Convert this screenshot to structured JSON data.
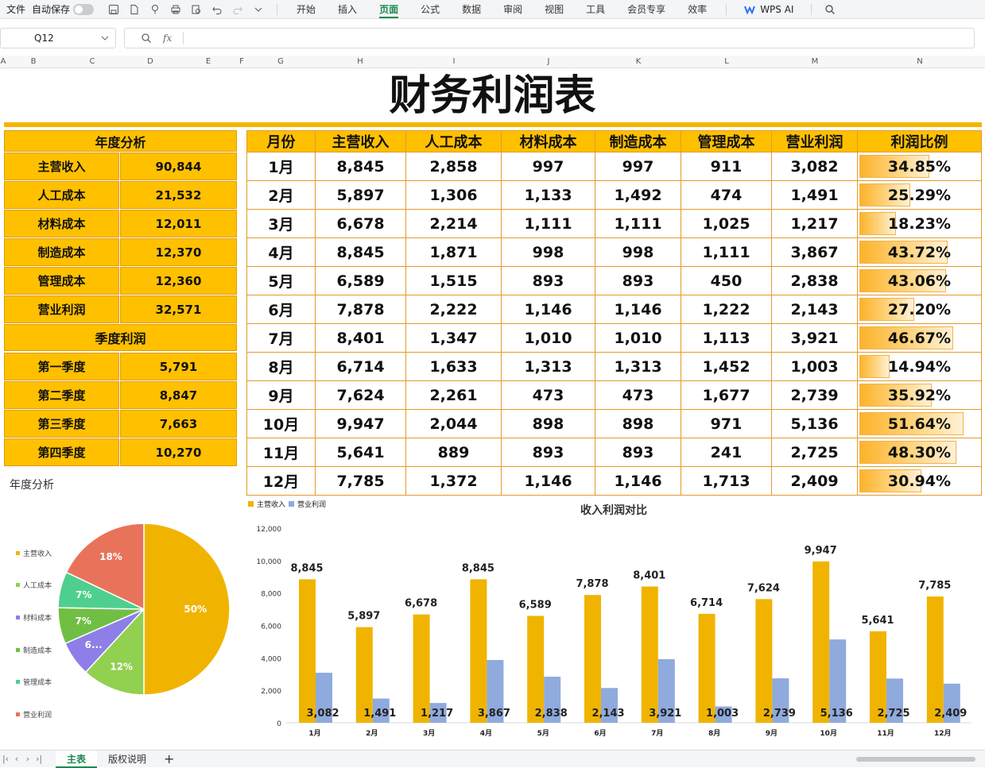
{
  "ribbon": {
    "file": "文件",
    "autosave": "自动保存",
    "menus": [
      "开始",
      "插入",
      "页面",
      "公式",
      "数据",
      "审阅",
      "视图",
      "工具",
      "会员专享",
      "效率"
    ],
    "active_menu": "页面",
    "wps_ai": "WPS AI"
  },
  "formula_bar": {
    "cell_ref": "Q12",
    "fx_label": "fx",
    "value": ""
  },
  "columns": [
    "A",
    "B",
    "C",
    "D",
    "E",
    "F",
    "G",
    "H",
    "I",
    "J",
    "K",
    "L",
    "M",
    "N"
  ],
  "title": "财务利润表",
  "annual": {
    "header": "年度分析",
    "rows": [
      {
        "label": "主营收入",
        "value": "90,844"
      },
      {
        "label": "人工成本",
        "value": "21,532"
      },
      {
        "label": "材料成本",
        "value": "12,011"
      },
      {
        "label": "制造成本",
        "value": "12,370"
      },
      {
        "label": "管理成本",
        "value": "12,360"
      },
      {
        "label": "营业利润",
        "value": "32,571"
      }
    ]
  },
  "quarter": {
    "header": "季度利润",
    "rows": [
      {
        "label": "第一季度",
        "value": "5,791"
      },
      {
        "label": "第二季度",
        "value": "8,847"
      },
      {
        "label": "第三季度",
        "value": "7,663"
      },
      {
        "label": "第四季度",
        "value": "10,270"
      }
    ]
  },
  "monthly": {
    "headers": [
      "月份",
      "主营收入",
      "人工成本",
      "材料成本",
      "制造成本",
      "管理成本",
      "营业利润",
      "利润比例"
    ],
    "rows": [
      [
        "1月",
        "8,845",
        "2,858",
        "997",
        "997",
        "911",
        "3,082",
        "34.85%"
      ],
      [
        "2月",
        "5,897",
        "1,306",
        "1,133",
        "1,492",
        "474",
        "1,491",
        "25.29%"
      ],
      [
        "3月",
        "6,678",
        "2,214",
        "1,111",
        "1,111",
        "1,025",
        "1,217",
        "18.23%"
      ],
      [
        "4月",
        "8,845",
        "1,871",
        "998",
        "998",
        "1,111",
        "3,867",
        "43.72%"
      ],
      [
        "5月",
        "6,589",
        "1,515",
        "893",
        "893",
        "450",
        "2,838",
        "43.06%"
      ],
      [
        "6月",
        "7,878",
        "2,222",
        "1,146",
        "1,146",
        "1,222",
        "2,143",
        "27.20%"
      ],
      [
        "7月",
        "8,401",
        "1,347",
        "1,010",
        "1,010",
        "1,113",
        "3,921",
        "46.67%"
      ],
      [
        "8月",
        "6,714",
        "1,633",
        "1,313",
        "1,313",
        "1,452",
        "1,003",
        "14.94%"
      ],
      [
        "9月",
        "7,624",
        "2,261",
        "473",
        "473",
        "1,677",
        "2,739",
        "35.92%"
      ],
      [
        "10月",
        "9,947",
        "2,044",
        "898",
        "898",
        "971",
        "5,136",
        "51.64%"
      ],
      [
        "11月",
        "5,641",
        "889",
        "893",
        "893",
        "241",
        "2,725",
        "48.30%"
      ],
      [
        "12月",
        "7,785",
        "1,372",
        "1,146",
        "1,146",
        "1,713",
        "2,409",
        "30.94%"
      ]
    ],
    "ratios": [
      34.85,
      25.29,
      18.23,
      43.72,
      43.06,
      27.2,
      46.67,
      14.94,
      35.92,
      51.64,
      48.3,
      30.94
    ]
  },
  "chart_data": [
    {
      "type": "pie",
      "title": "年度分析",
      "labels": [
        "主营收入",
        "人工成本",
        "材料成本",
        "制造成本",
        "管理成本",
        "营业利润"
      ],
      "values": [
        90844,
        21532,
        12011,
        12370,
        12360,
        32571
      ],
      "display_labels": [
        "50%",
        "12%",
        "6...",
        "7%",
        "7%",
        "18%"
      ],
      "colors": [
        "#f0b400",
        "#92d050",
        "#8e7ee8",
        "#70bf44",
        "#4fcf8f",
        "#e8735a"
      ]
    },
    {
      "type": "bar",
      "title": "收入利润对比",
      "categories": [
        "1月",
        "2月",
        "3月",
        "4月",
        "5月",
        "6月",
        "7月",
        "8月",
        "9月",
        "10月",
        "11月",
        "12月"
      ],
      "series": [
        {
          "name": "主营收入",
          "color": "#f0b400",
          "values": [
            8845,
            5897,
            6678,
            8845,
            6589,
            7878,
            8401,
            6714,
            7624,
            9947,
            5641,
            7785
          ]
        },
        {
          "name": "营业利润",
          "color": "#8faadc",
          "values": [
            3082,
            1491,
            1217,
            3867,
            2838,
            2143,
            3921,
            1003,
            2739,
            5136,
            2725,
            2409
          ]
        }
      ],
      "yticks": [
        "0",
        "2,000",
        "4,000",
        "6,000",
        "8,000",
        "10,000",
        "12,000"
      ],
      "ylim": [
        0,
        12000
      ],
      "legend": "top-left"
    }
  ],
  "sheet_tabs": {
    "tabs": [
      "主表",
      "版权说明"
    ],
    "active": "主表",
    "add": "+"
  }
}
